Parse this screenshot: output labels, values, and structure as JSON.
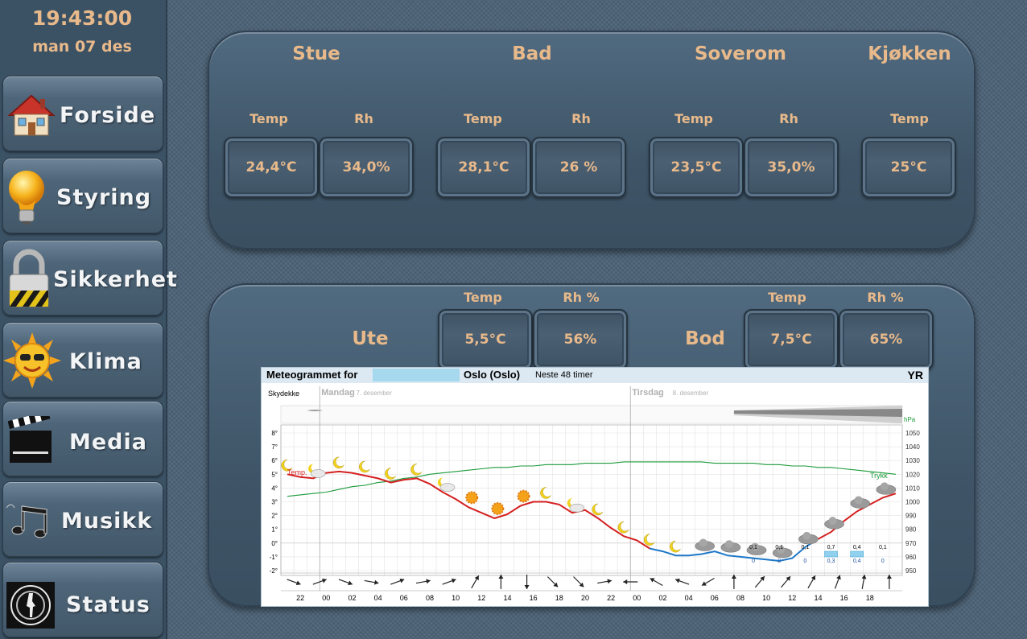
{
  "clock": {
    "time": "19:43:00",
    "date": "man 07 des"
  },
  "nav": [
    {
      "label": "Forside",
      "icon": "house-icon"
    },
    {
      "label": "Styring",
      "icon": "light-bulb-icon"
    },
    {
      "label": "Sikkerhet",
      "icon": "padlock-icon"
    },
    {
      "label": "Klima",
      "icon": "sun-icon"
    },
    {
      "label": "Media",
      "icon": "clapperboard-icon"
    },
    {
      "label": "Musikk",
      "icon": "music-notes-icon"
    },
    {
      "label": "Status",
      "icon": "gun-barrel-icon"
    }
  ],
  "indoor": {
    "rooms": [
      {
        "name": "Stue",
        "temp_label": "Temp",
        "temp": "24,4°C",
        "rh_label": "Rh",
        "rh": "34,0%"
      },
      {
        "name": "Bad",
        "temp_label": "Temp",
        "temp": "28,1°C",
        "rh_label": "Rh",
        "rh": "26 %"
      },
      {
        "name": "Soverom",
        "temp_label": "Temp",
        "temp": "23,5°C",
        "rh_label": "Rh",
        "rh": "35,0%"
      },
      {
        "name": "Kjøkken",
        "temp_label": "Temp",
        "temp": "25°C"
      }
    ]
  },
  "outdoor": {
    "ute": {
      "name": "Ute",
      "temp_label": "Temp",
      "temp": "5,5°C",
      "rh_label": "Rh %",
      "rh": "56%"
    },
    "bod": {
      "name": "Bod",
      "temp_label": "Temp",
      "temp": "7,5°C",
      "rh_label": "Rh %",
      "rh": "65%"
    }
  },
  "meteogram": {
    "title": "Meteogrammet for",
    "location": "Oslo (Oslo)",
    "span": "Neste 48 timer",
    "brand": "YR",
    "cloud_label": "Skydekke",
    "day1": "Mandag",
    "day1_date": "7. desember",
    "day2": "Tirsdag",
    "day2_date": "8. desember",
    "temp_label": "Temp.",
    "pressure_label": "Trykk",
    "pressure_unit": "hPa",
    "precip_labels": [
      "0,1",
      "0,1",
      "0,1",
      "0,7",
      "0,4",
      "0,1"
    ],
    "precip_lower": [
      "0",
      "0",
      "0",
      "0,3",
      "0,4",
      "0"
    ]
  },
  "chart_data": {
    "type": "line",
    "x": [
      "21",
      "22",
      "23",
      "00",
      "01",
      "02",
      "03",
      "04",
      "05",
      "06",
      "07",
      "08",
      "09",
      "10",
      "11",
      "12",
      "13",
      "14",
      "15",
      "16",
      "17",
      "18",
      "19",
      "20",
      "21",
      "22",
      "23",
      "00",
      "01",
      "02",
      "03",
      "04",
      "05",
      "06",
      "07",
      "08",
      "09",
      "10",
      "11",
      "12",
      "13",
      "14",
      "15",
      "16",
      "17",
      "18",
      "19",
      "20"
    ],
    "x_tick_labels": [
      "22",
      "00",
      "02",
      "04",
      "06",
      "08",
      "10",
      "12",
      "14",
      "16",
      "18",
      "20",
      "22",
      "00",
      "02",
      "04",
      "06",
      "08",
      "10",
      "12",
      "14",
      "16",
      "18"
    ],
    "series": [
      {
        "name": "Temp.",
        "axis": "left",
        "values": [
          5.0,
          4.8,
          4.7,
          5.1,
          5.2,
          5.1,
          4.9,
          4.7,
          4.4,
          4.6,
          4.7,
          4.3,
          3.7,
          3.2,
          2.6,
          2.2,
          1.8,
          2.1,
          2.7,
          3.0,
          3.0,
          2.8,
          2.2,
          2.4,
          1.8,
          1.1,
          0.5,
          0.2,
          -0.4,
          -0.6,
          -0.9,
          -0.9,
          -0.8,
          -0.6,
          -0.9,
          -1.0,
          -1.1,
          -1.2,
          -1.3,
          -1.1,
          -0.3,
          0.3,
          0.8,
          1.6,
          2.3,
          2.8,
          3.3,
          3.6
        ]
      },
      {
        "name": "Trykk",
        "axis": "right",
        "values": [
          1004,
          1005,
          1006,
          1007,
          1009,
          1011,
          1012,
          1014,
          1015,
          1017,
          1018,
          1020,
          1021,
          1022,
          1023,
          1024,
          1025,
          1025,
          1026,
          1026,
          1027,
          1027,
          1027,
          1028,
          1028,
          1028,
          1029,
          1029,
          1029,
          1029,
          1029,
          1029,
          1029,
          1028,
          1028,
          1028,
          1028,
          1027,
          1027,
          1026,
          1026,
          1025,
          1025,
          1024,
          1023,
          1022,
          1021,
          1020
        ]
      }
    ],
    "ylim_left": [
      -2,
      8
    ],
    "ylim_right": [
      950,
      1050
    ],
    "y_ticks_left": [
      "8°",
      "7°",
      "6°",
      "5°",
      "4°",
      "3°",
      "2°",
      "1°",
      "0°",
      "-1°",
      "-2°"
    ],
    "y_ticks_right": [
      "1050",
      "1040",
      "1030",
      "1020",
      "1010",
      "1000",
      "990",
      "980",
      "970",
      "960",
      "950"
    ],
    "grid": true
  }
}
